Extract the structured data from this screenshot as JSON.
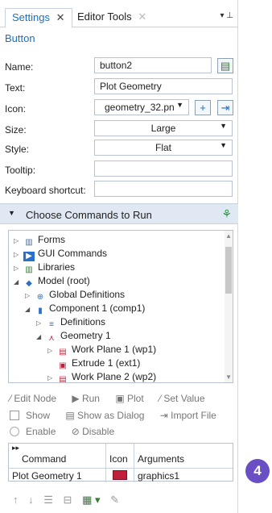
{
  "tabs": [
    {
      "label": "Settings",
      "close": "✕"
    },
    {
      "label": "Editor Tools",
      "close": "✕"
    }
  ],
  "tab_menu": "▾ ⊥",
  "section_title": "Button",
  "form": {
    "name_label": "Name:",
    "name_value": "button2",
    "text_label": "Text:",
    "text_value": "Plot Geometry",
    "icon_label": "Icon:",
    "icon_value": "geometry_32.pn",
    "size_label": "Size:",
    "size_value": "Large",
    "style_label": "Style:",
    "style_value": "Flat",
    "tooltip_label": "Tooltip:",
    "tooltip_value": "",
    "shortcut_label": "Keyboard shortcut:",
    "shortcut_value": ""
  },
  "commands_header": "Choose Commands to Run",
  "tree": [
    {
      "label": "Forms",
      "level": 0,
      "arrow": "▷",
      "icon": "forms-icon"
    },
    {
      "label": "GUI Commands",
      "level": 0,
      "arrow": "▷",
      "icon": "gui-commands-icon"
    },
    {
      "label": "Libraries",
      "level": 0,
      "arrow": "▷",
      "icon": "libraries-icon"
    },
    {
      "label": "Model (root)",
      "level": 0,
      "arrow": "◢",
      "icon": "model-icon"
    },
    {
      "label": "Global Definitions",
      "level": 1,
      "arrow": "▷",
      "icon": "globe-icon"
    },
    {
      "label": "Component 1 (comp1)",
      "level": 1,
      "arrow": "◢",
      "icon": "component-icon"
    },
    {
      "label": "Definitions",
      "level": 2,
      "arrow": "▷",
      "icon": "definitions-icon"
    },
    {
      "label": "Geometry 1",
      "level": 2,
      "arrow": "◢",
      "icon": "geometry-icon"
    },
    {
      "label": "Work Plane 1 (wp1)",
      "level": 3,
      "arrow": "▷",
      "icon": "work-plane-icon"
    },
    {
      "label": "Extrude 1 (ext1)",
      "level": 3,
      "arrow": "",
      "icon": "extrude-icon"
    },
    {
      "label": "Work Plane 2 (wp2)",
      "level": 3,
      "arrow": "▷",
      "icon": "work-plane-icon"
    }
  ],
  "actions": {
    "edit_node": "Edit Node",
    "run": "Run",
    "plot": "Plot",
    "set_value": "Set Value",
    "show": "Show",
    "show_as_dialog": "Show as Dialog",
    "import_file": "Import File",
    "enable": "Enable",
    "disable": "Disable"
  },
  "table": {
    "headers": [
      "Command",
      "Icon",
      "Arguments"
    ],
    "rows": [
      {
        "command": "Plot Geometry 1",
        "arguments": "graphics1"
      }
    ]
  },
  "badge": "4",
  "colors": {
    "accent": "#1a6fbf",
    "header_bg": "#dfe8f3",
    "badge": "#6a4fc4"
  }
}
